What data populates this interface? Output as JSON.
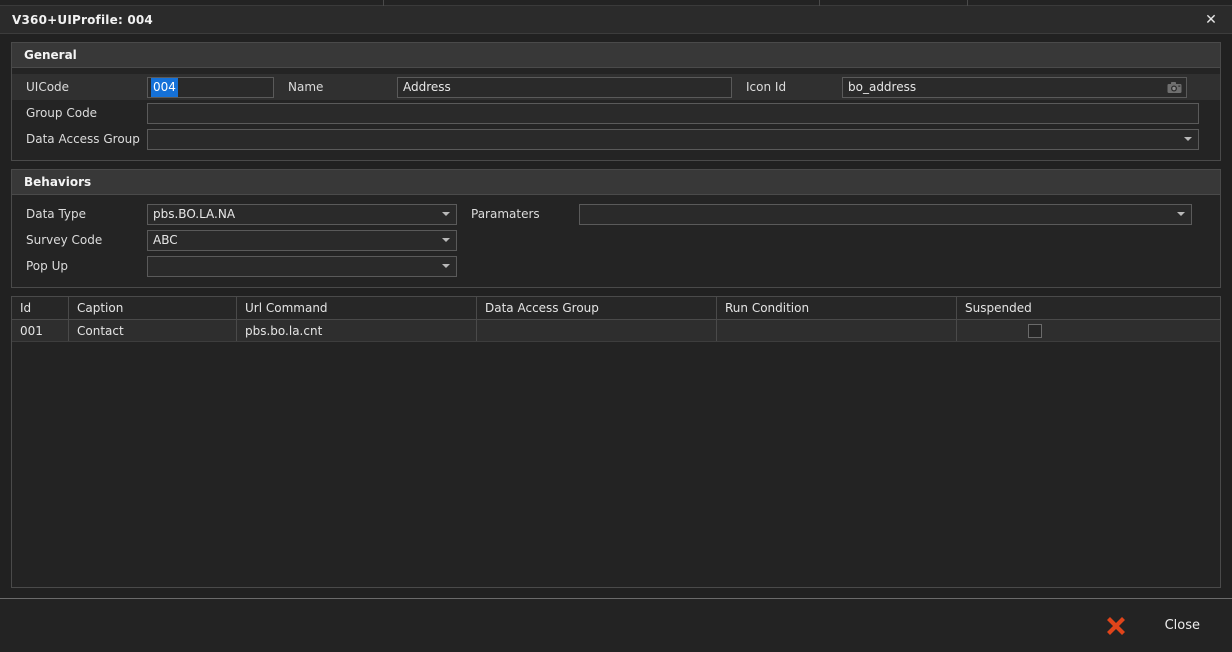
{
  "window": {
    "title": "V360+UIProfile: 004",
    "close_icon": "close-icon"
  },
  "tabstrip": {
    "segments": [
      384,
      436,
      148,
      264
    ]
  },
  "general": {
    "header": "General",
    "uicode": {
      "label": "UICode",
      "value": "004",
      "selected": true
    },
    "name": {
      "label": "Name",
      "value": "Address"
    },
    "icon_id": {
      "label": "Icon Id",
      "value": "bo_address",
      "button_icon": "camera-icon"
    },
    "group_code": {
      "label": "Group Code",
      "value": ""
    },
    "data_access_group": {
      "label": "Data Access Group",
      "value": ""
    }
  },
  "behaviors": {
    "header": "Behaviors",
    "data_type": {
      "label": "Data Type",
      "value": "pbs.BO.LA.NA"
    },
    "parameters": {
      "label": "Paramaters",
      "value": ""
    },
    "survey_code": {
      "label": "Survey Code",
      "value": "ABC"
    },
    "pop_up": {
      "label": "Pop Up",
      "value": ""
    }
  },
  "grid": {
    "columns": [
      "Id",
      "Caption",
      "Url Command",
      "Data Access Group",
      "Run Condition",
      "Suspended"
    ],
    "rows": [
      {
        "id": "001",
        "caption": "Contact",
        "url_command": "pbs.bo.la.cnt",
        "data_access_group": "",
        "run_condition": "",
        "suspended": false
      }
    ]
  },
  "footer": {
    "close_label": "Close",
    "close_icon": "x-mark-icon",
    "close_icon_color": "#e0441a"
  }
}
